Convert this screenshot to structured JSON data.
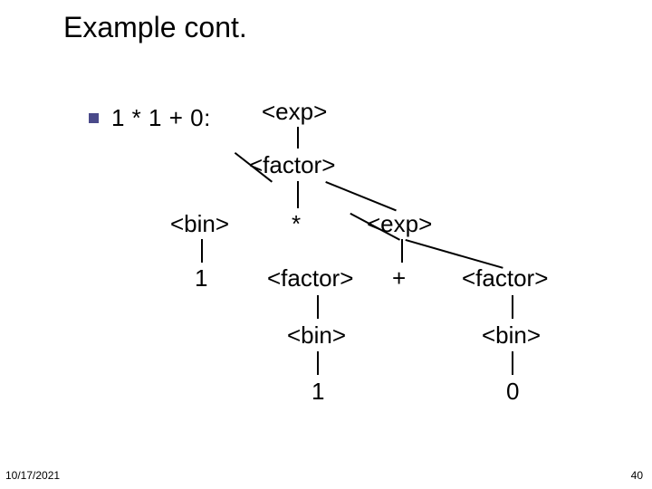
{
  "title": "Example cont.",
  "bullet_text": "1 * 1 + 0:",
  "footer": {
    "date": "10/17/2021",
    "page": "40"
  },
  "tree": {
    "exp_root": "<exp>",
    "factor_root": "<factor>",
    "bin_left": "<bin>",
    "star": "*",
    "exp_right": "<exp>",
    "one_left": "1",
    "factor_mid": "<factor>",
    "plus": "+",
    "factor_right": "<factor>",
    "bin_mid": "<bin>",
    "bin_right": "<bin>",
    "one_mid": "1",
    "zero_right": "0"
  }
}
